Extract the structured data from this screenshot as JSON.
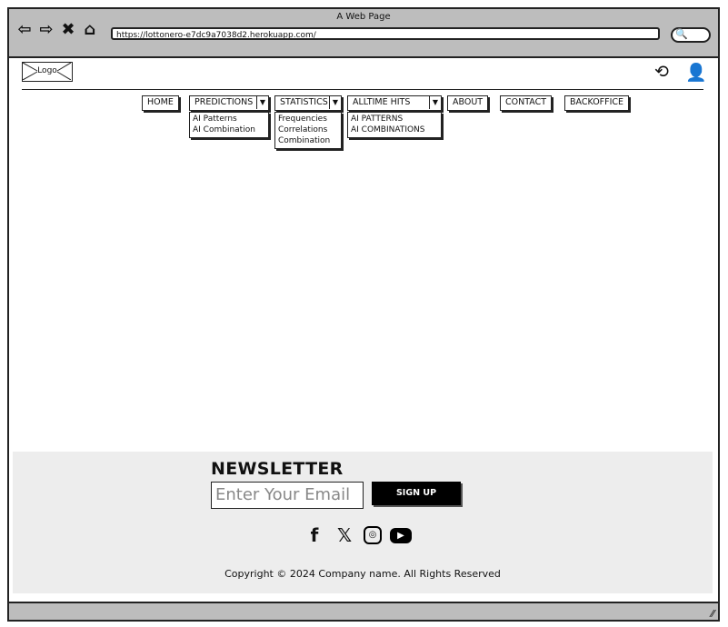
{
  "window": {
    "title": "A Web Page"
  },
  "browser": {
    "url": "https://lottonero-e7dc9a7038d2.herokuapp.com/",
    "back_icon": "⇦",
    "forward_icon": "⇨",
    "close_icon": "✖",
    "home_icon": "⌂",
    "search_icon": "🔍"
  },
  "header": {
    "logo": "Logo",
    "history_icon": "⟲",
    "user_icon": "👤"
  },
  "nav": {
    "home": "HOME",
    "predictions": {
      "label": "PREDICTIONS",
      "items": [
        "AI Patterns",
        "AI Combination"
      ]
    },
    "statistics": {
      "label": "STATISTICS",
      "items": [
        "Frequencies",
        "Correlations",
        "Combination"
      ]
    },
    "alltime": {
      "label": "ALLTIME HITS",
      "items": [
        "AI PATTERNS",
        "AI COMBINATIONS"
      ]
    },
    "about": "ABOUT",
    "contact": "CONTACT",
    "backoffice": "BACKOFFICE",
    "caret": "▼"
  },
  "footer": {
    "newsletter_title": "NEWSLETTER",
    "email_placeholder": "Enter Your Email",
    "signup_label": "SIGN UP",
    "social": {
      "facebook": "f",
      "x": "𝕏",
      "instagram": "◎",
      "youtube": "▶"
    },
    "copyright": "Copyright © 2024 Company name. All Rights Reserved"
  },
  "colors": {
    "chrome": "#bdbdbd",
    "footer_bg": "#ededed",
    "button": "#000000"
  }
}
